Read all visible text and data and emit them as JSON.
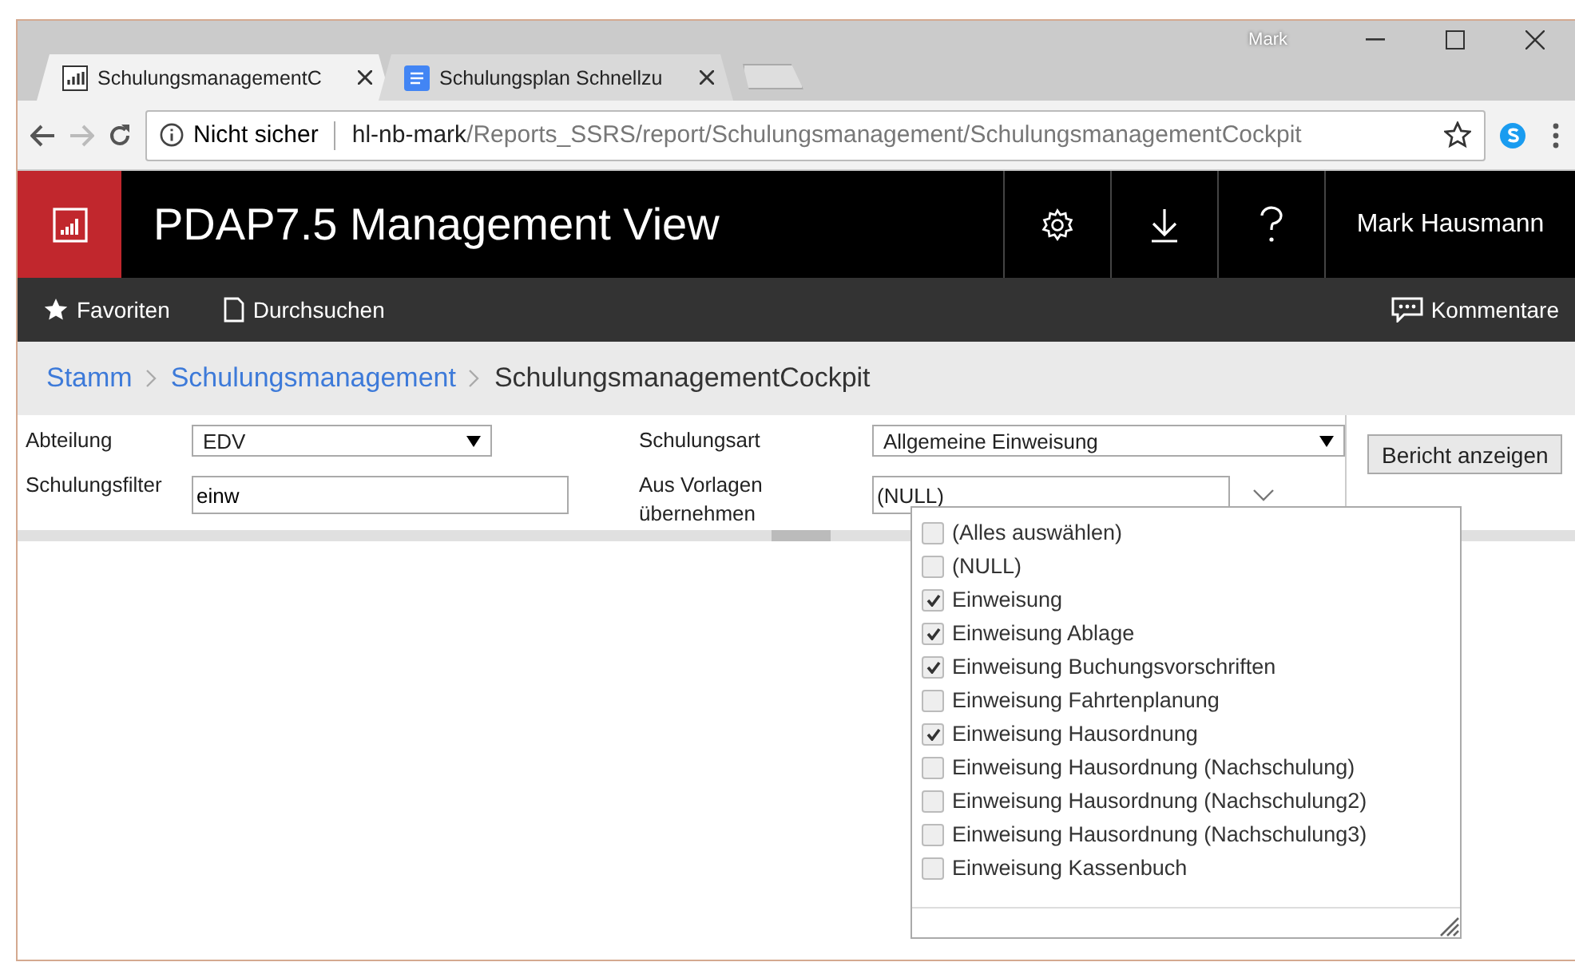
{
  "browser": {
    "profile": "Mark",
    "tabs": [
      {
        "title": "SchulungsmanagementC",
        "selected": true,
        "kind": "report"
      },
      {
        "title": "Schulungsplan Schnellzu",
        "selected": false,
        "kind": "doc"
      }
    ],
    "address": {
      "security": "Nicht sicher",
      "host": "hl-nb-mark",
      "path": "/Reports_SSRS/report/Schulungsmanagement/SchulungsmanagementCockpit"
    }
  },
  "header": {
    "title": "PDAP7.5 Management View",
    "user": "Mark Hausmann"
  },
  "nav": {
    "items": [
      {
        "label": "Favoriten",
        "kind": "star"
      },
      {
        "label": "Durchsuchen",
        "kind": "page"
      }
    ],
    "comments": "Kommentare"
  },
  "breadcrumb": {
    "items": [
      "Stamm",
      "Schulungsmanagement"
    ],
    "current": "SchulungsmanagementCockpit"
  },
  "parameters": [
    {
      "label": "Abteilung",
      "kind": "select",
      "value": "EDV"
    },
    {
      "label": "Schulungsart",
      "kind": "select",
      "value": "Allgemeine Einweisung"
    },
    {
      "label": "Schulungsfilter",
      "kind": "text",
      "value": "einw"
    },
    {
      "label": "Aus Vorlagen übernehmen",
      "kind": "multi",
      "value": "(NULL)"
    }
  ],
  "view_report_button": "Bericht anzeigen",
  "dropdown": {
    "options": [
      {
        "label": "(Alles auswählen)",
        "checked": false
      },
      {
        "label": "(NULL)",
        "checked": false
      },
      {
        "label": "Einweisung",
        "checked": true
      },
      {
        "label": "Einweisung Ablage",
        "checked": true
      },
      {
        "label": "Einweisung Buchungsvorschriften",
        "checked": true
      },
      {
        "label": "Einweisung Fahrtenplanung",
        "checked": false
      },
      {
        "label": "Einweisung Hausordnung",
        "checked": true
      },
      {
        "label": "Einweisung Hausordnung (Nachschulung)",
        "checked": false
      },
      {
        "label": "Einweisung Hausordnung (Nachschulung2)",
        "checked": false
      },
      {
        "label": "Einweisung Hausordnung (Nachschulung3)",
        "checked": false
      },
      {
        "label": "Einweisung Kassenbuch",
        "checked": false
      }
    ]
  }
}
